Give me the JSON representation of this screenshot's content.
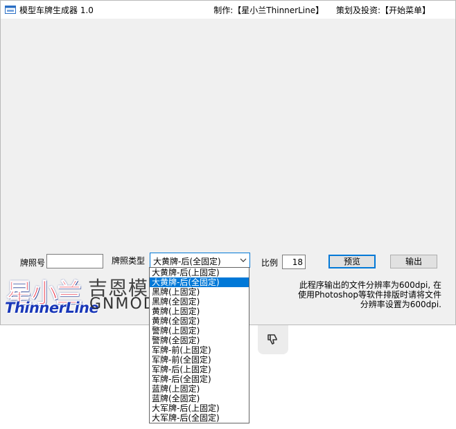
{
  "window": {
    "title": "模型车牌生成器 1.0",
    "author": "制作:【星小兰ThinnerLine】",
    "sponsor": "策划及投资:【开始菜单】"
  },
  "form": {
    "plate_number_label": "牌照号",
    "plate_number_value": "",
    "plate_type_label": "牌照类型",
    "plate_type_value": "大黄牌-后(全固定)",
    "scale_label": "比例",
    "scale_value": "18",
    "preview_button": "预览",
    "export_button": "输出"
  },
  "logo": {
    "brand_cn": "星小兰",
    "brand_en": "ThinnerLine",
    "partner_cn": "吉恩模",
    "partner_en": "GNMODE"
  },
  "notice": {
    "line1": "此程序输出的文件分辨率为600dpi, 在",
    "line2": "使用Photoshop等软件排版时请将文件",
    "line3": "分辨率设置为600dpi."
  },
  "dropdown": {
    "selected_index": 1,
    "options": [
      "大黄牌-后(上固定)",
      "大黄牌-后(全固定)",
      "黑牌(上固定)",
      "黑牌(全固定)",
      "黄牌(上固定)",
      "黄牌(全固定)",
      "警牌(上固定)",
      "警牌(全固定)",
      "军牌-前(上固定)",
      "军牌-前(全固定)",
      "军牌-后(上固定)",
      "军牌-后(全固定)",
      "蓝牌(上固定)",
      "蓝牌(全固定)",
      "大军牌-后(上固定)",
      "大军牌-后(全固定)"
    ]
  },
  "colors": {
    "accent": "#0078d7",
    "window_bg": "#f0f0f0",
    "logo_red": "#e8142a",
    "logo_blue": "#1a38b8"
  },
  "icons": {
    "app": "app-window-icon",
    "combo_arrow": "chevron-down-icon",
    "feedback": "thumbs-down-icon"
  }
}
